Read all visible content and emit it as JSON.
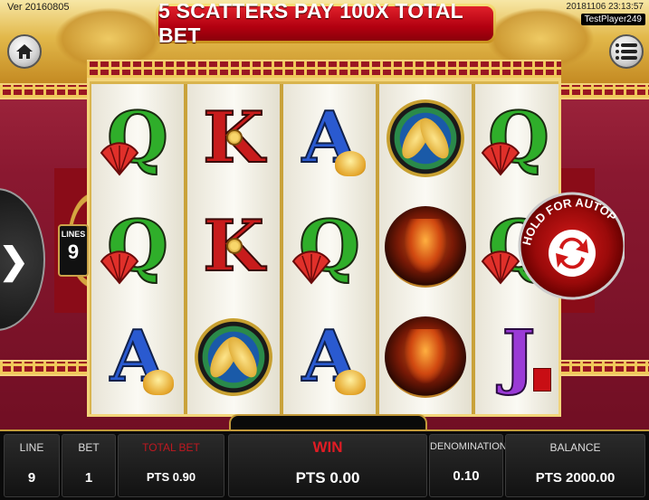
{
  "header": {
    "version": "Ver 20160805",
    "datetime": "20181106 23:13:57",
    "player": "TestPlayer249",
    "banner": "5 SCATTERS PAY 100X TOTAL BET"
  },
  "icons": {
    "home": "home-icon",
    "menu": "menu-icon",
    "next": "chevron-right-icon",
    "autoplay": "refresh-icon"
  },
  "lines_badge": {
    "label": "LINES",
    "value": "9"
  },
  "autoplay": {
    "label": "HOLD FOR AUTOPLAY"
  },
  "reels": [
    [
      "Q",
      "Q",
      "A"
    ],
    [
      "K",
      "K",
      "KOI"
    ],
    [
      "A",
      "Q",
      "A"
    ],
    [
      "KOI",
      "PHOENIX",
      "PHOENIX"
    ],
    [
      "Q",
      "Q",
      "J"
    ]
  ],
  "footer": {
    "line": {
      "label": "LINE",
      "value": "9"
    },
    "bet": {
      "label": "BET",
      "value": "1"
    },
    "total_bet": {
      "label": "TOTAL BET",
      "value": "PTS 0.90"
    },
    "win": {
      "label": "WIN",
      "value": "PTS 0.00"
    },
    "denomination": {
      "label": "DENOMINATION",
      "value": "0.10"
    },
    "balance": {
      "label": "BALANCE",
      "value": "PTS 2000.00"
    }
  },
  "colors": {
    "accent_gold": "#c39a3a",
    "banner_red": "#b20010",
    "win_red": "#e01c24",
    "q_green": "#2fae2a",
    "k_red": "#c81c1c",
    "a_blue": "#2a5ad0",
    "j_purple": "#9a3ad6"
  }
}
